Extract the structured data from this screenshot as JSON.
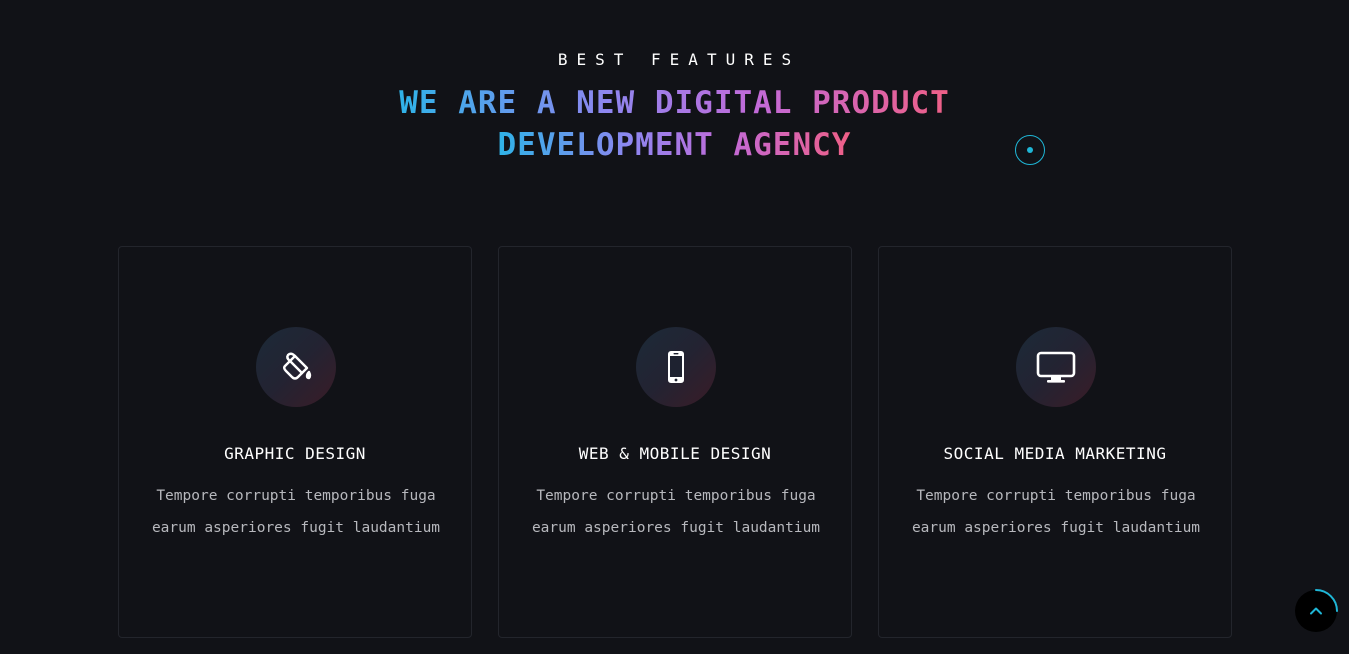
{
  "header": {
    "eyebrow": "BEST FEATURES",
    "headline_line1": "WE ARE A NEW DIGITAL PRODUCT",
    "headline_line2": "DEVELOPMENT AGENCY"
  },
  "features": [
    {
      "icon": "paint-bucket-icon",
      "title": "GRAPHIC DESIGN",
      "text": "Tempore corrupti temporibus fuga earum asperiores fugit laudantium"
    },
    {
      "icon": "mobile-phone-icon",
      "title": "WEB & MOBILE DESIGN",
      "text": "Tempore corrupti temporibus fuga earum asperiores fugit laudantium"
    },
    {
      "icon": "desktop-monitor-icon",
      "title": "SOCIAL MEDIA MARKETING",
      "text": "Tempore corrupti temporibus fuga earum asperiores fugit laudantium"
    }
  ],
  "colors": {
    "background": "#111217",
    "accent": "#1fb6d6",
    "gradient_start": "#2fb3e8",
    "gradient_end": "#ef5f86"
  },
  "scroll_top": {
    "icon": "chevron-up-icon"
  }
}
